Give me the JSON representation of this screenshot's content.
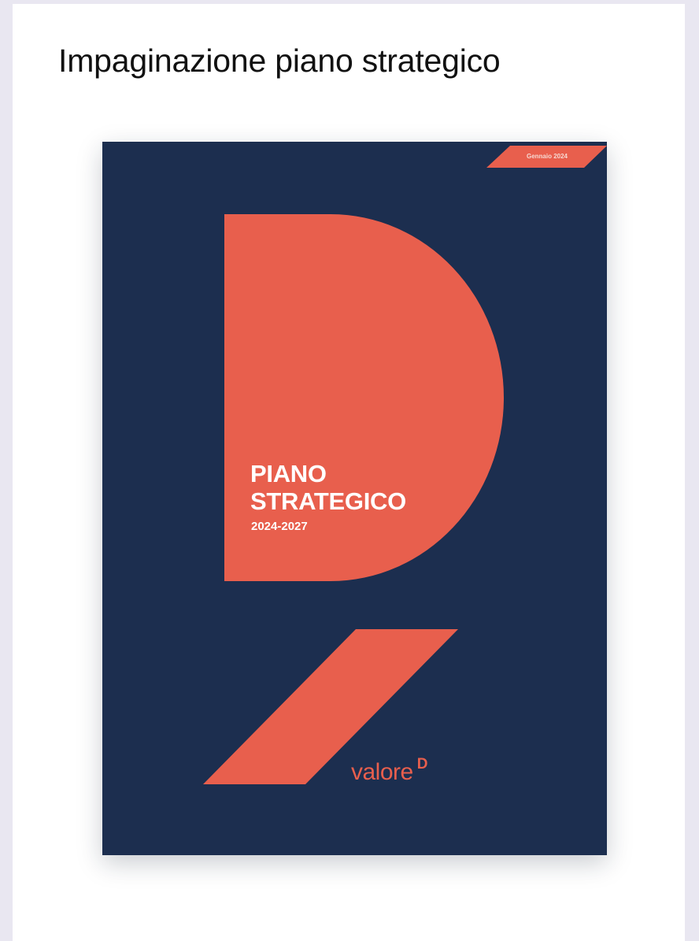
{
  "card": {
    "title": "Impaginazione piano strategico"
  },
  "cover": {
    "date_tag": "Gennaio 2024",
    "title_line1": "PIANO",
    "title_line2": "STRATEGICO",
    "years": "2024-2027",
    "logo_word": "valore",
    "logo_mark": "D"
  },
  "colors": {
    "page_background": "#e9e7f1",
    "card_background": "#ffffff",
    "cover_navy": "#1c2e4f",
    "accent_coral": "#e85f4d"
  }
}
